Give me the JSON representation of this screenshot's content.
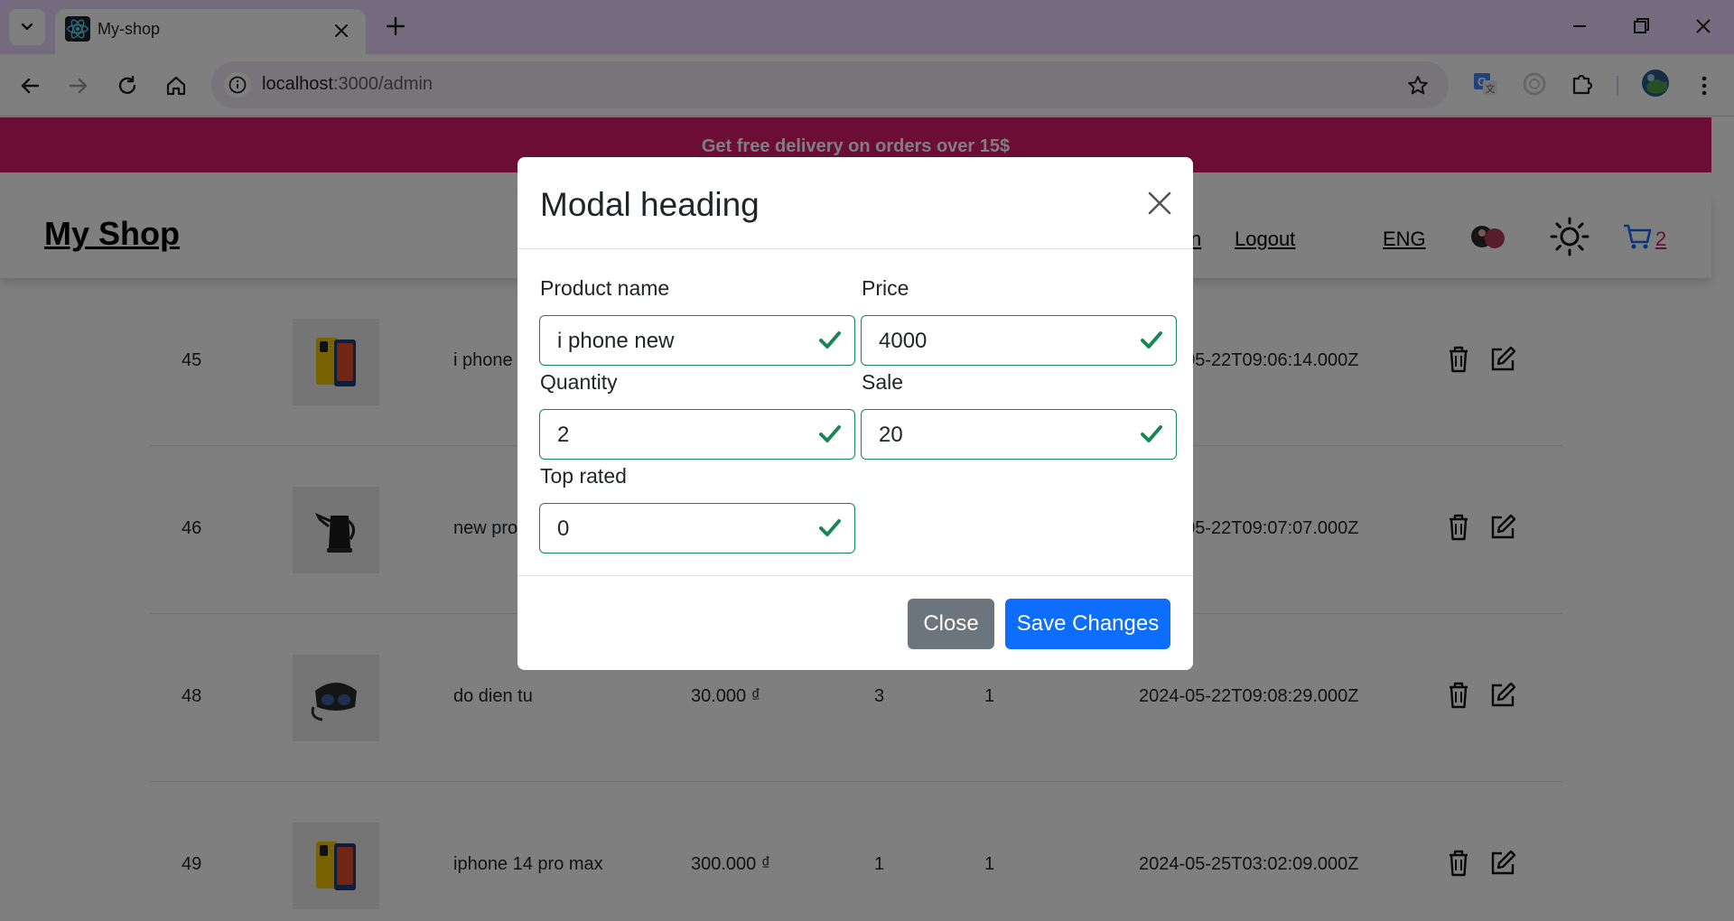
{
  "browser": {
    "tab_title": "My-shop",
    "url_host": "localhost",
    "url_path": ":3000/admin"
  },
  "page": {
    "promo": "Get free delivery on orders over 15$",
    "brand": "My Shop",
    "nav": {
      "admin_partial": "n",
      "logout": "Logout",
      "language": "ENG",
      "cart_count": "2"
    },
    "products": [
      {
        "id": "45",
        "name": "i phone new",
        "price": "",
        "quantity": "",
        "top_rated": "",
        "created_at": "2024-05-22T09:06:14.000Z",
        "image": "phone-yellow"
      },
      {
        "id": "46",
        "name": "new product",
        "price": "",
        "quantity": "",
        "top_rated": "",
        "created_at": "2024-05-22T09:07:07.000Z",
        "image": "kettle-black"
      },
      {
        "id": "48",
        "name": "do dien tu",
        "price": "30.000 ₫",
        "quantity": "3",
        "top_rated": "1",
        "created_at": "2024-05-22T09:08:29.000Z",
        "image": "vr-headset"
      },
      {
        "id": "49",
        "name": "iphone 14 pro max",
        "price": "300.000 ₫",
        "quantity": "1",
        "top_rated": "1",
        "created_at": "2024-05-25T03:02:09.000Z",
        "image": "phone-yellow"
      }
    ]
  },
  "modal": {
    "title": "Modal heading",
    "fields": {
      "product_name": {
        "label": "Product name",
        "value": "i phone new"
      },
      "price": {
        "label": "Price",
        "value": "4000"
      },
      "quantity": {
        "label": "Quantity",
        "value": "2"
      },
      "sale": {
        "label": "Sale",
        "value": "20"
      },
      "top_rated": {
        "label": "Top rated",
        "value": "0"
      }
    },
    "close_label": "Close",
    "save_label": "Save Changes"
  },
  "colors": {
    "promo_bg": "#d81b6a",
    "valid_green": "#198754",
    "primary": "#0d6efd",
    "secondary": "#6c757d"
  }
}
